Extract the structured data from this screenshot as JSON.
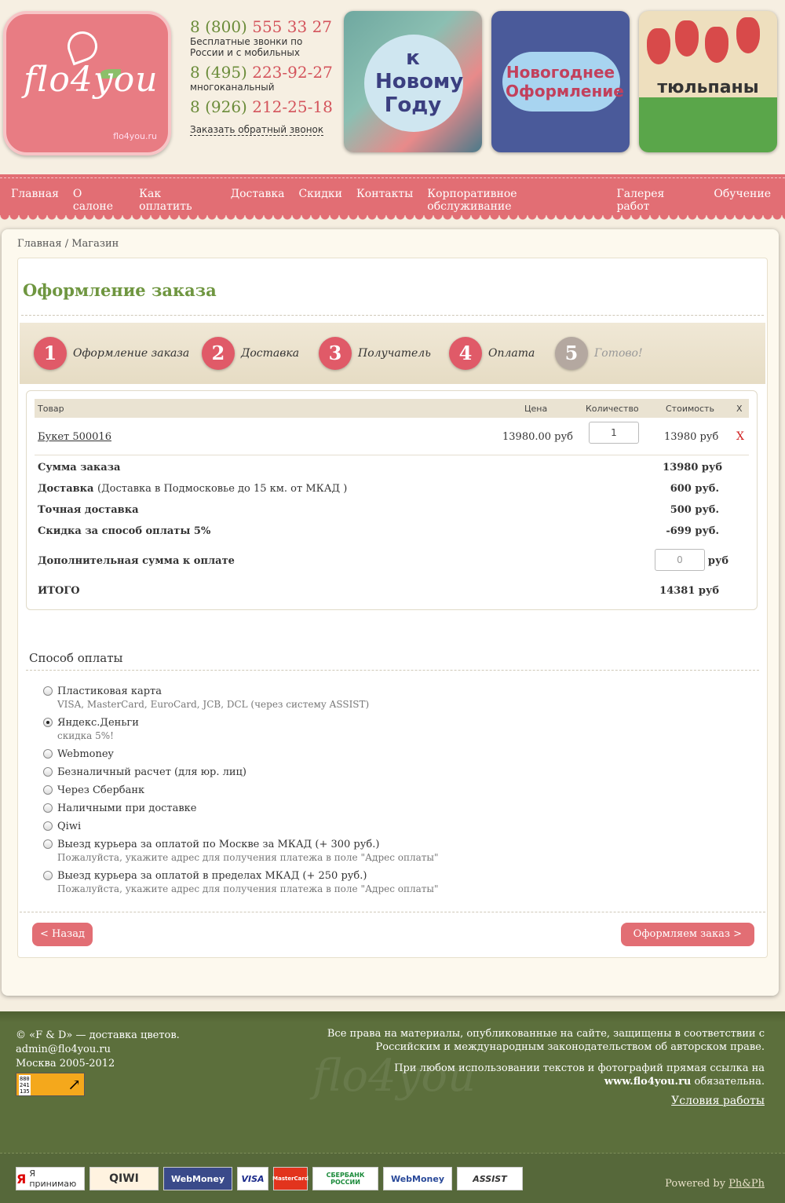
{
  "header": {
    "logo_text": "flo4you",
    "logo_sub": "flo4you.ru",
    "phones": [
      {
        "code": "8 (800)",
        "number": "555 33 27",
        "note": "Бесплатные звонки по России и с мобильных"
      },
      {
        "code": "8 (495)",
        "number": "223-92-27",
        "note": "многоканальный"
      },
      {
        "code": "8 (926)",
        "number": "212-25-18",
        "note": ""
      }
    ],
    "callback": "Заказать обратный звонок",
    "banners": [
      {
        "text": "к Новому Году"
      },
      {
        "text": "Новогоднее Оформление"
      },
      {
        "text": "тюльпаны"
      }
    ]
  },
  "nav": {
    "items": [
      "Главная",
      "О салоне",
      "Как оплатить",
      "Доставка",
      "Скидки",
      "Контакты",
      "Корпоративное обслуживание",
      "Галерея работ",
      "Обучение"
    ]
  },
  "breadcrumb": {
    "home": "Главная",
    "separator": "/",
    "current": "Магазин"
  },
  "page_title": "Оформление заказа",
  "steps": [
    {
      "num": "1",
      "label": "Оформление заказа"
    },
    {
      "num": "2",
      "label": "Доставка"
    },
    {
      "num": "3",
      "label": "Получатель"
    },
    {
      "num": "4",
      "label": "Оплата"
    },
    {
      "num": "5",
      "label": "Готово!"
    }
  ],
  "cart": {
    "headers": {
      "item": "Товар",
      "price": "Цена",
      "qty": "Количество",
      "cost": "Стоимость",
      "remove": "X"
    },
    "item": {
      "name": "Букет 500016",
      "price": "13980.00 руб",
      "qty": "1",
      "cost": "13980 руб",
      "remove": "X"
    },
    "summary": {
      "order_sum_label": "Сумма заказа",
      "order_sum_value": "13980 руб",
      "delivery_label": "Доставка",
      "delivery_note": "(Доставка в Подмосковье до 15 км. от МКАД )",
      "delivery_value": "600 руб.",
      "exact_label": "Точная доставка",
      "exact_value": "500 руб.",
      "discount_label": "Скидка за способ оплаты 5%",
      "discount_value": "-699 руб.",
      "extra_label": "Дополнительная сумма к оплате",
      "extra_value": "0",
      "extra_unit": "руб",
      "total_label": "ИТОГО",
      "total_value": "14381 руб"
    }
  },
  "payment": {
    "title": "Способ оплаты",
    "options": [
      {
        "label": "Пластиковая карта",
        "note": "VISA, MasterCard, EuroCard, JCB, DCL (через систему ASSIST)",
        "selected": false
      },
      {
        "label": "Яндекс.Деньги",
        "note": "скидка 5%!",
        "selected": true
      },
      {
        "label": "Webmoney",
        "note": "",
        "selected": false
      },
      {
        "label": "Безналичный расчет (для юр. лиц)",
        "note": "",
        "selected": false
      },
      {
        "label": "Через Сбербанк",
        "note": "",
        "selected": false
      },
      {
        "label": "Наличными при доставке",
        "note": "",
        "selected": false
      },
      {
        "label": "Qiwi",
        "note": "",
        "selected": false
      },
      {
        "label": "Выезд курьера за оплатой по Москве за МКАД (+ 300 руб.)",
        "note": "Пожалуйста, укажите адрес для получения платежа в поле \"Адрес оплаты\"",
        "selected": false
      },
      {
        "label": "Выезд курьера за оплатой в пределах МКАД (+ 250 руб.)",
        "note": "Пожалуйста, укажите адрес для получения платежа в поле \"Адрес оплаты\"",
        "selected": false
      }
    ]
  },
  "buttons": {
    "back": "< Назад",
    "submit": "Оформляем заказ >"
  },
  "footer": {
    "company": "© «F & D» — доставка цветов.",
    "email": "admin@flo4you.ru",
    "city_years": "Москва 2005-2012",
    "counter_digits": "880\n241\n135",
    "counter_arrow": "↗",
    "rights": "Все права на материалы, опубликованные на сайте, защищены в соответствии с Российским и международным законодательством об авторском праве.",
    "link_notice_pre": "При любом использовании текстов и фотографий прямая ссылка на",
    "link_notice_site": "www.flo4you.ru",
    "link_notice_post": "обязательна.",
    "terms": "Условия работы",
    "watermark": "flo4you",
    "pay_logos": [
      "Я принимаю",
      "QIWI",
      "WebMoney",
      "VISA",
      "MasterCard",
      "СБЕРБАНК РОССИИ",
      "WebMoney",
      "ASSIST"
    ],
    "powered_pre": "Powered by",
    "powered_link": "Ph&Ph"
  }
}
